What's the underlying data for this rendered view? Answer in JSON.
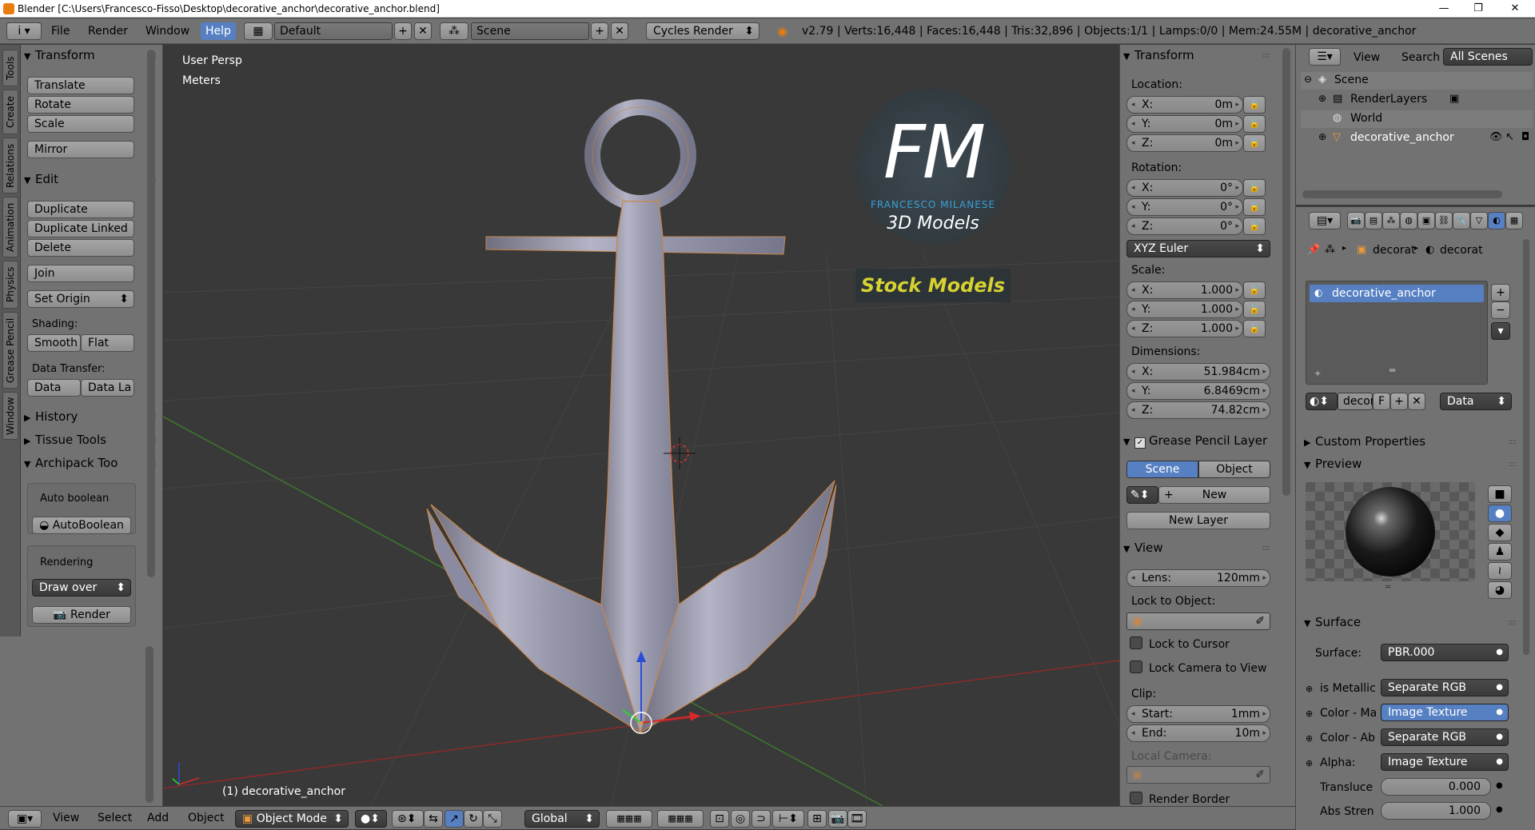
{
  "window": {
    "title": "Blender [C:\\Users\\Francesco-Fisso\\Desktop\\decorative_anchor\\decorative_anchor.blend]",
    "minimize": "—",
    "maximize": "❐",
    "close": "✕"
  },
  "menubar": {
    "info_icon": "i",
    "menus": [
      "File",
      "Render",
      "Window",
      "Help"
    ],
    "layout": "Default",
    "scene": "Scene",
    "engine": "Cycles Render",
    "stats": "v2.79 | Verts:16,448 | Faces:16,448 | Tris:32,896 | Objects:1/1 | Lamps:0/0 | Mem:24.55M | decorative_anchor"
  },
  "left_tabs": [
    "Tools",
    "Create",
    "Relations",
    "Animation",
    "Physics",
    "Grease Pencil",
    "Window"
  ],
  "tool_panel": {
    "transform_header": "Transform",
    "transform_buttons": [
      "Translate",
      "Rotate",
      "Scale"
    ],
    "mirror": "Mirror",
    "edit_header": "Edit",
    "edit_buttons": [
      "Duplicate",
      "Duplicate Linked",
      "Delete"
    ],
    "join": "Join",
    "set_origin": "Set Origin",
    "shading_label": "Shading:",
    "smooth": "Smooth",
    "flat": "Flat",
    "data_transfer_label": "Data Transfer:",
    "data": "Data",
    "data_la": "Data La",
    "history": "History",
    "tissue_tools": "Tissue Tools",
    "archipack": "Archipack Too",
    "auto_boolean_label": "Auto boolean",
    "auto_boolean_btn": "AutoBoolean",
    "rendering_label": "Rendering",
    "draw_over": "Draw over",
    "render_btn": "Render"
  },
  "viewport": {
    "view_name": "User Persp",
    "units": "Meters",
    "object_label": "(1) decorative_anchor",
    "logo_fm": "FM",
    "logo_name": "FRANCESCO MILANESE",
    "logo_3d": "3D Models",
    "logo_stock": "Stock Models"
  },
  "n_panel": {
    "transform_header": "Transform",
    "location_label": "Location:",
    "location": [
      {
        "k": "X:",
        "v": "0m"
      },
      {
        "k": "Y:",
        "v": "0m"
      },
      {
        "k": "Z:",
        "v": "0m"
      }
    ],
    "rotation_label": "Rotation:",
    "rotation": [
      {
        "k": "X:",
        "v": "0°"
      },
      {
        "k": "Y:",
        "v": "0°"
      },
      {
        "k": "Z:",
        "v": "0°"
      }
    ],
    "rotation_mode": "XYZ Euler",
    "scale_label": "Scale:",
    "scale": [
      {
        "k": "X:",
        "v": "1.000"
      },
      {
        "k": "Y:",
        "v": "1.000"
      },
      {
        "k": "Z:",
        "v": "1.000"
      }
    ],
    "dimensions_label": "Dimensions:",
    "dimensions": [
      {
        "k": "X:",
        "v": "51.984cm"
      },
      {
        "k": "Y:",
        "v": "6.8469cm"
      },
      {
        "k": "Z:",
        "v": "74.82cm"
      }
    ],
    "grease_header": "Grease Pencil Layer",
    "gp_scene": "Scene",
    "gp_object": "Object",
    "gp_new": "New",
    "gp_new_layer": "New Layer",
    "view_header": "View",
    "lens_k": "Lens:",
    "lens_v": "120mm",
    "lock_to_object": "Lock to Object:",
    "lock_to_cursor": "Lock to Cursor",
    "lock_camera": "Lock Camera to View",
    "clip_label": "Clip:",
    "clip_start_k": "Start:",
    "clip_start_v": "1mm",
    "clip_end_k": "End:",
    "clip_end_v": "10m",
    "local_camera": "Local Camera:",
    "render_border": "Render Border"
  },
  "outliner": {
    "view": "View",
    "search": "Search",
    "all_scenes": "All Scenes",
    "items": [
      "Scene",
      "RenderLayers",
      "World",
      "decorative_anchor"
    ]
  },
  "properties": {
    "breadcrumb1": "decorat",
    "breadcrumb2": "decorat",
    "material_slot": "decorative_anchor",
    "mat_name": "decor",
    "f": "F",
    "data_dropdown": "Data",
    "custom_props": "Custom Properties",
    "preview": "Preview",
    "surface_header": "Surface",
    "surface_label": "Surface:",
    "surface_value": "PBR.000",
    "rows": [
      {
        "label": "is Metallic",
        "value": "Separate RGB"
      },
      {
        "label": "Color - Ma",
        "value": "Image Texture"
      },
      {
        "label": "Color - Ab",
        "value": "Separate RGB"
      },
      {
        "label": "Alpha:",
        "value": "Image Texture"
      }
    ],
    "transluce_label": "Transluce",
    "transluce_value": "0.000",
    "abs_label": "Abs Stren",
    "abs_value": "1.000"
  },
  "bottombar": {
    "view": "View",
    "select": "Select",
    "add": "Add",
    "object": "Object",
    "mode": "Object Mode",
    "orientation": "Global"
  },
  "colors": {
    "accent": "#5680c2",
    "anchor": "#9c9cb0",
    "logo_blue": "#3aa0d8",
    "logo_yellow": "#d7d232"
  }
}
